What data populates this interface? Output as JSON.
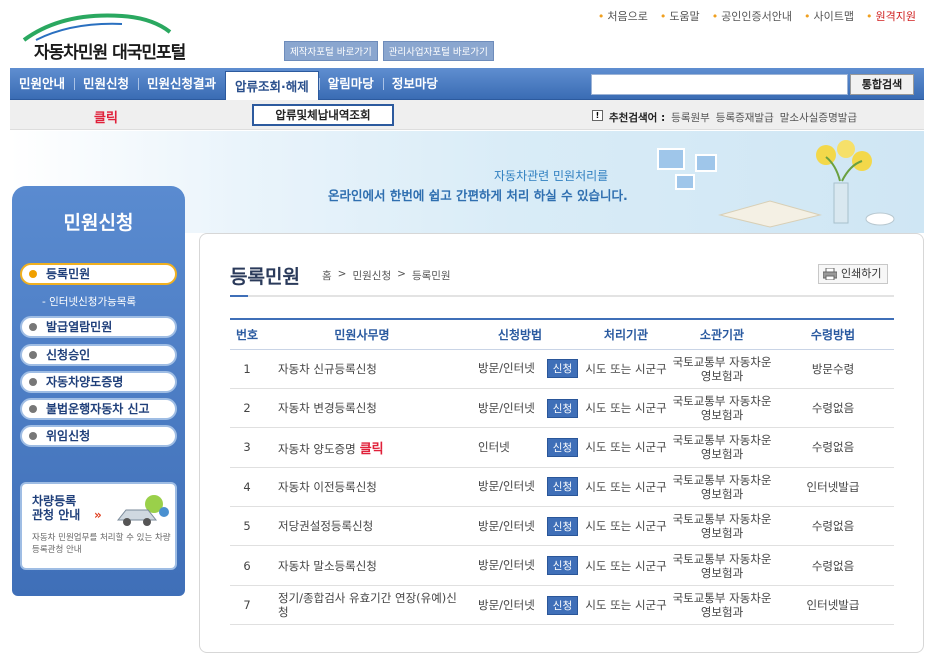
{
  "header": {
    "logo_text": "자동차민원 대국민포털",
    "util_links": [
      "처음으로",
      "도움말",
      "공인인증서안내",
      "사이트맵",
      "원격지원"
    ],
    "portal_buttons": [
      "제작자포털 바로가기",
      "관리사업자포털 바로가기"
    ]
  },
  "gnb": {
    "menus": [
      "민원안내",
      "민원신청",
      "민원신청결과",
      "압류조회·해제",
      "알림마당",
      "정보마당"
    ],
    "search_placeholder": "",
    "search_button": "통합검색",
    "dropdown_item": "압류및체납내역조회"
  },
  "annotations": {
    "click_label_1": "클릭",
    "click_label_2": "클릭"
  },
  "recommend": {
    "label": "추천검색어 :",
    "terms": [
      "등록원부",
      "등록증재발급",
      "말소사실증명발급"
    ]
  },
  "banner": {
    "line1": "자동차관련 민원처리를",
    "line2": "온라인에서 한번에 쉽고 간편하게 처리 하실 수 있습니다."
  },
  "lnb": {
    "title": "민원신청",
    "items": [
      "등록민원",
      "발급열람민원",
      "신청승인",
      "자동차양도증명",
      "불법운행자동차 신고",
      "위임신청"
    ],
    "sub_item": "인터넷신청가능목록",
    "info_title_1": "차량등록",
    "info_title_2": "관청 안내",
    "info_desc": "자동차 민원업무를 처리할 수 있는 차량등록관청 안내"
  },
  "content": {
    "title": "등록민원",
    "breadcrumb": [
      "홈",
      "민원신청",
      "등록민원"
    ],
    "print_label": "인쇄하기",
    "table": {
      "headers": [
        "번호",
        "민원사무명",
        "신청방법",
        "처리기관",
        "소관기관",
        "수령방법"
      ],
      "apply_label": "신청",
      "rows": [
        {
          "no": "1",
          "name": "자동차 신규등록신청",
          "method": "방문/인터넷",
          "agency": "시도 또는 시군구",
          "dept": "국토교통부 자동차운영보험과",
          "receive": "방문수령"
        },
        {
          "no": "2",
          "name": "자동차 변경등록신청",
          "method": "방문/인터넷",
          "agency": "시도 또는 시군구",
          "dept": "국토교통부 자동차운영보험과",
          "receive": "수령없음"
        },
        {
          "no": "3",
          "name": "자동차 양도증명",
          "method": "인터넷",
          "agency": "시도 또는 시군구",
          "dept": "국토교통부 자동차운영보험과",
          "receive": "수령없음"
        },
        {
          "no": "4",
          "name": "자동차 이전등록신청",
          "method": "방문/인터넷",
          "agency": "시도 또는 시군구",
          "dept": "국토교통부 자동차운영보험과",
          "receive": "인터넷발급"
        },
        {
          "no": "5",
          "name": "저당권설정등록신청",
          "method": "방문/인터넷",
          "agency": "시도 또는 시군구",
          "dept": "국토교통부 자동차운영보험과",
          "receive": "수령없음"
        },
        {
          "no": "6",
          "name": "자동차 말소등록신청",
          "method": "방문/인터넷",
          "agency": "시도 또는 시군구",
          "dept": "국토교통부 자동차운영보험과",
          "receive": "수령없음"
        },
        {
          "no": "7",
          "name": "정기/종합검사 유효기간 연장(유예)신청",
          "method": "방문/인터넷",
          "agency": "시도 또는 시군구",
          "dept": "국토교통부 자동차운영보험과",
          "receive": "인터넷발급"
        }
      ]
    }
  },
  "colors": {
    "brand_blue": "#3f6fb8",
    "accent_red": "#e0203a",
    "accent_orange": "#f0a000"
  }
}
